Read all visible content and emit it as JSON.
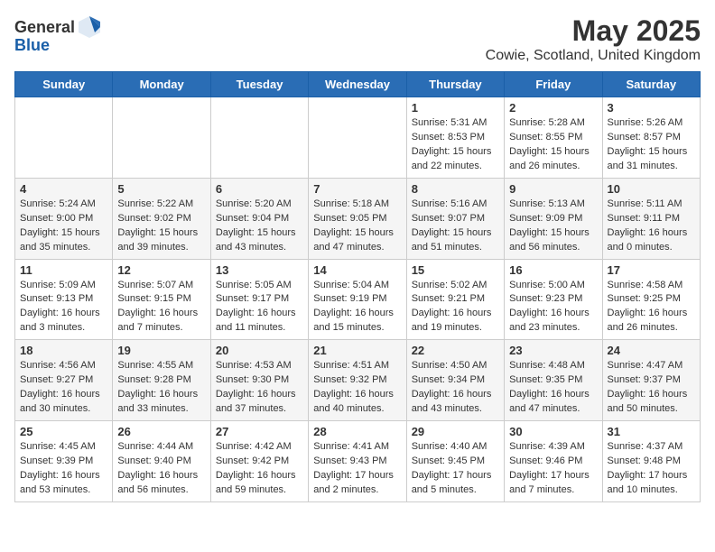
{
  "logo": {
    "text_general": "General",
    "text_blue": "Blue"
  },
  "title": "May 2025",
  "location": "Cowie, Scotland, United Kingdom",
  "weekdays": [
    "Sunday",
    "Monday",
    "Tuesday",
    "Wednesday",
    "Thursday",
    "Friday",
    "Saturday"
  ],
  "weeks": [
    [
      {
        "day": "",
        "info": ""
      },
      {
        "day": "",
        "info": ""
      },
      {
        "day": "",
        "info": ""
      },
      {
        "day": "",
        "info": ""
      },
      {
        "day": "1",
        "info": "Sunrise: 5:31 AM\nSunset: 8:53 PM\nDaylight: 15 hours\nand 22 minutes."
      },
      {
        "day": "2",
        "info": "Sunrise: 5:28 AM\nSunset: 8:55 PM\nDaylight: 15 hours\nand 26 minutes."
      },
      {
        "day": "3",
        "info": "Sunrise: 5:26 AM\nSunset: 8:57 PM\nDaylight: 15 hours\nand 31 minutes."
      }
    ],
    [
      {
        "day": "4",
        "info": "Sunrise: 5:24 AM\nSunset: 9:00 PM\nDaylight: 15 hours\nand 35 minutes."
      },
      {
        "day": "5",
        "info": "Sunrise: 5:22 AM\nSunset: 9:02 PM\nDaylight: 15 hours\nand 39 minutes."
      },
      {
        "day": "6",
        "info": "Sunrise: 5:20 AM\nSunset: 9:04 PM\nDaylight: 15 hours\nand 43 minutes."
      },
      {
        "day": "7",
        "info": "Sunrise: 5:18 AM\nSunset: 9:05 PM\nDaylight: 15 hours\nand 47 minutes."
      },
      {
        "day": "8",
        "info": "Sunrise: 5:16 AM\nSunset: 9:07 PM\nDaylight: 15 hours\nand 51 minutes."
      },
      {
        "day": "9",
        "info": "Sunrise: 5:13 AM\nSunset: 9:09 PM\nDaylight: 15 hours\nand 56 minutes."
      },
      {
        "day": "10",
        "info": "Sunrise: 5:11 AM\nSunset: 9:11 PM\nDaylight: 16 hours\nand 0 minutes."
      }
    ],
    [
      {
        "day": "11",
        "info": "Sunrise: 5:09 AM\nSunset: 9:13 PM\nDaylight: 16 hours\nand 3 minutes."
      },
      {
        "day": "12",
        "info": "Sunrise: 5:07 AM\nSunset: 9:15 PM\nDaylight: 16 hours\nand 7 minutes."
      },
      {
        "day": "13",
        "info": "Sunrise: 5:05 AM\nSunset: 9:17 PM\nDaylight: 16 hours\nand 11 minutes."
      },
      {
        "day": "14",
        "info": "Sunrise: 5:04 AM\nSunset: 9:19 PM\nDaylight: 16 hours\nand 15 minutes."
      },
      {
        "day": "15",
        "info": "Sunrise: 5:02 AM\nSunset: 9:21 PM\nDaylight: 16 hours\nand 19 minutes."
      },
      {
        "day": "16",
        "info": "Sunrise: 5:00 AM\nSunset: 9:23 PM\nDaylight: 16 hours\nand 23 minutes."
      },
      {
        "day": "17",
        "info": "Sunrise: 4:58 AM\nSunset: 9:25 PM\nDaylight: 16 hours\nand 26 minutes."
      }
    ],
    [
      {
        "day": "18",
        "info": "Sunrise: 4:56 AM\nSunset: 9:27 PM\nDaylight: 16 hours\nand 30 minutes."
      },
      {
        "day": "19",
        "info": "Sunrise: 4:55 AM\nSunset: 9:28 PM\nDaylight: 16 hours\nand 33 minutes."
      },
      {
        "day": "20",
        "info": "Sunrise: 4:53 AM\nSunset: 9:30 PM\nDaylight: 16 hours\nand 37 minutes."
      },
      {
        "day": "21",
        "info": "Sunrise: 4:51 AM\nSunset: 9:32 PM\nDaylight: 16 hours\nand 40 minutes."
      },
      {
        "day": "22",
        "info": "Sunrise: 4:50 AM\nSunset: 9:34 PM\nDaylight: 16 hours\nand 43 minutes."
      },
      {
        "day": "23",
        "info": "Sunrise: 4:48 AM\nSunset: 9:35 PM\nDaylight: 16 hours\nand 47 minutes."
      },
      {
        "day": "24",
        "info": "Sunrise: 4:47 AM\nSunset: 9:37 PM\nDaylight: 16 hours\nand 50 minutes."
      }
    ],
    [
      {
        "day": "25",
        "info": "Sunrise: 4:45 AM\nSunset: 9:39 PM\nDaylight: 16 hours\nand 53 minutes."
      },
      {
        "day": "26",
        "info": "Sunrise: 4:44 AM\nSunset: 9:40 PM\nDaylight: 16 hours\nand 56 minutes."
      },
      {
        "day": "27",
        "info": "Sunrise: 4:42 AM\nSunset: 9:42 PM\nDaylight: 16 hours\nand 59 minutes."
      },
      {
        "day": "28",
        "info": "Sunrise: 4:41 AM\nSunset: 9:43 PM\nDaylight: 17 hours\nand 2 minutes."
      },
      {
        "day": "29",
        "info": "Sunrise: 4:40 AM\nSunset: 9:45 PM\nDaylight: 17 hours\nand 5 minutes."
      },
      {
        "day": "30",
        "info": "Sunrise: 4:39 AM\nSunset: 9:46 PM\nDaylight: 17 hours\nand 7 minutes."
      },
      {
        "day": "31",
        "info": "Sunrise: 4:37 AM\nSunset: 9:48 PM\nDaylight: 17 hours\nand 10 minutes."
      }
    ]
  ]
}
